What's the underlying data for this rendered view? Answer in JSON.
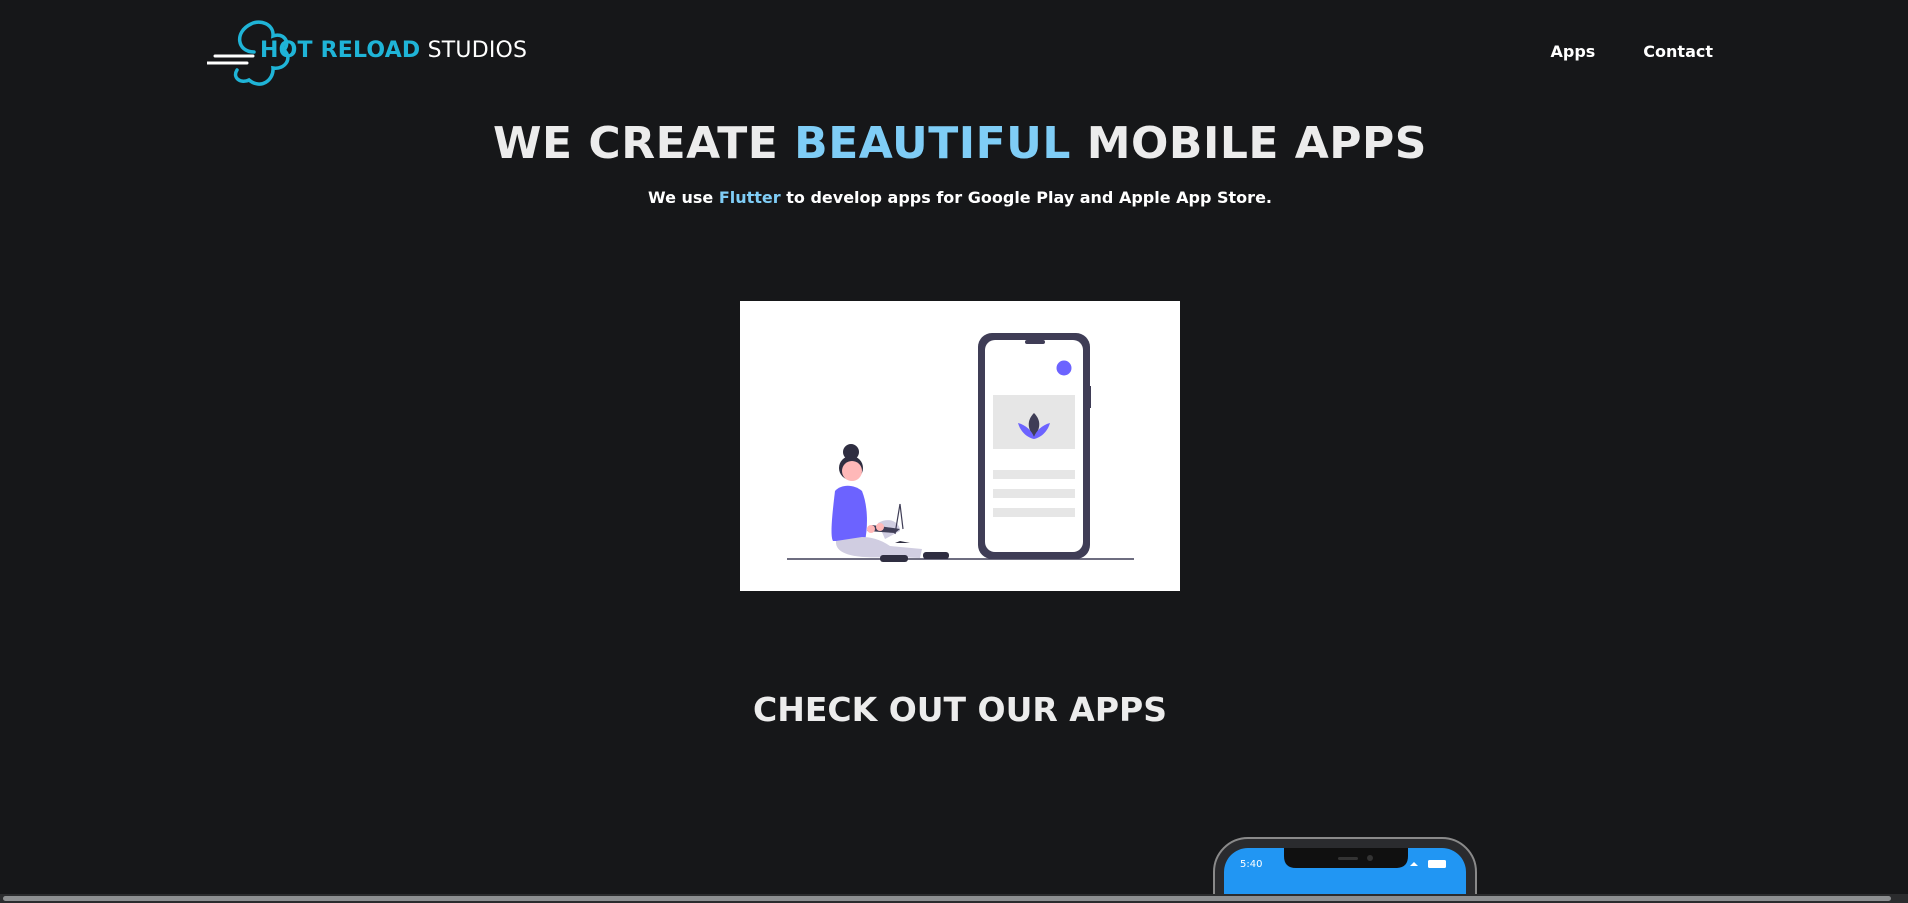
{
  "header": {
    "logo_hot": "HOT RELOAD",
    "logo_studios": " STUDIOS",
    "nav": [
      {
        "label": "Apps"
      },
      {
        "label": "Contact"
      }
    ]
  },
  "hero": {
    "title_part1": "WE CREATE ",
    "title_accent": "BEAUTIFUL",
    "title_part2": " MOBILE APPS",
    "sub_part1": "We use ",
    "sub_accent": "Flutter",
    "sub_part2": " to develop apps for Google Play and Apple App Store."
  },
  "apps_section": {
    "title": "CHECK OUT OUR APPS",
    "phone_time": "5:40"
  },
  "colors": {
    "background": "#161719",
    "logo_accent": "#1fb4d7",
    "title_accent": "#7fcdf6",
    "illustration_purple": "#6c63ff",
    "phone_screen_blue": "#2196f3"
  },
  "icons": {
    "logo": "cloud-motion-logo-icon",
    "illustration": "person-with-phone-illustration",
    "phone": "smartphone-preview"
  }
}
